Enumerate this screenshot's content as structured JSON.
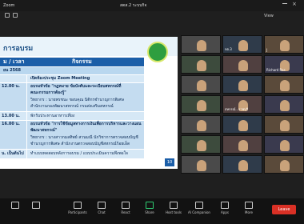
{
  "window": {
    "app_title": "Zoom",
    "meeting_title": "สตส.2 ระบบกิจ"
  },
  "toolbar": {
    "view_label": "View",
    "sign_in_label": "Sign in"
  },
  "slide": {
    "title": "การอบรม",
    "col_time": "ม / เวลา",
    "col_activity": "กิจกรรม",
    "date": "ยน 2568",
    "rows": [
      {
        "time": "",
        "lines": [
          "เปิดห้องประชุม Zoom Meeting"
        ]
      },
      {
        "time": "12.00 น.",
        "lines": [
          "อบรมหัวข้อ \"กฎหมาย ข้อบังคับและระเบียบสหกรณ์ที่",
          "คณะกรรมการต้องรู้\"",
          "วิทยากร : นายพรชนะ ขอบคุณ นิติกรชำนาญการพิเศษ",
          "สำนักงานกองพัฒนาสหกรณ์ กรมส่งเสริมสหกรณ์"
        ]
      },
      {
        "time": "13.00 น.",
        "lines": [
          "พักรับประทานอาหารเที่ยง"
        ]
      },
      {
        "time": "16.00 น.",
        "lines": [
          "อบรมหัวข้อ \"การใช้ข้อมูลทางการเงินเพื่อการบริหารและวางแผน",
          "พัฒนาสหกรณ์\"",
          "วิทยากร : นางสาวกมลทิพย์ สวนมณี นักวิชาการตรวจสอบบัญชี",
          "ชำนาญการพิเศษ สำนักงานตรวจสอบบัญชีสหกรณ์ร้อยเอ็ด"
        ]
      },
      {
        "time": "น. เป็นต้นไป",
        "lines": [
          "ทำแบบทดสอบหลังการอบรม / แบบประเมินความพึงพอใจ"
        ]
      }
    ],
    "page": "10"
  },
  "gallery": {
    "tiles": [
      {
        "name": ""
      },
      {
        "name": "กต.3"
      },
      {
        "name": "J"
      },
      {
        "name": ""
      },
      {
        "name": ""
      },
      {
        "name": "Richard Ras"
      },
      {
        "name": ""
      },
      {
        "name": ""
      },
      {
        "name": ""
      },
      {
        "name": ""
      },
      {
        "name": "สหกรณ์...ราชบุรี"
      },
      {
        "name": ""
      },
      {
        "name": ""
      },
      {
        "name": ""
      },
      {
        "name": ""
      },
      {
        "name": ""
      },
      {
        "name": ""
      },
      {
        "name": ""
      },
      {
        "name": ""
      },
      {
        "name": ""
      },
      {
        "name": ""
      }
    ]
  },
  "bottombar": {
    "items": [
      "Participants",
      "Chat",
      "React",
      "Share",
      "Host tools",
      "AI Companion",
      "Apps",
      "More"
    ],
    "leave_label": "Leave"
  },
  "colors": {
    "slide_blue": "#1b5ea8",
    "leave_red": "#d93025"
  }
}
